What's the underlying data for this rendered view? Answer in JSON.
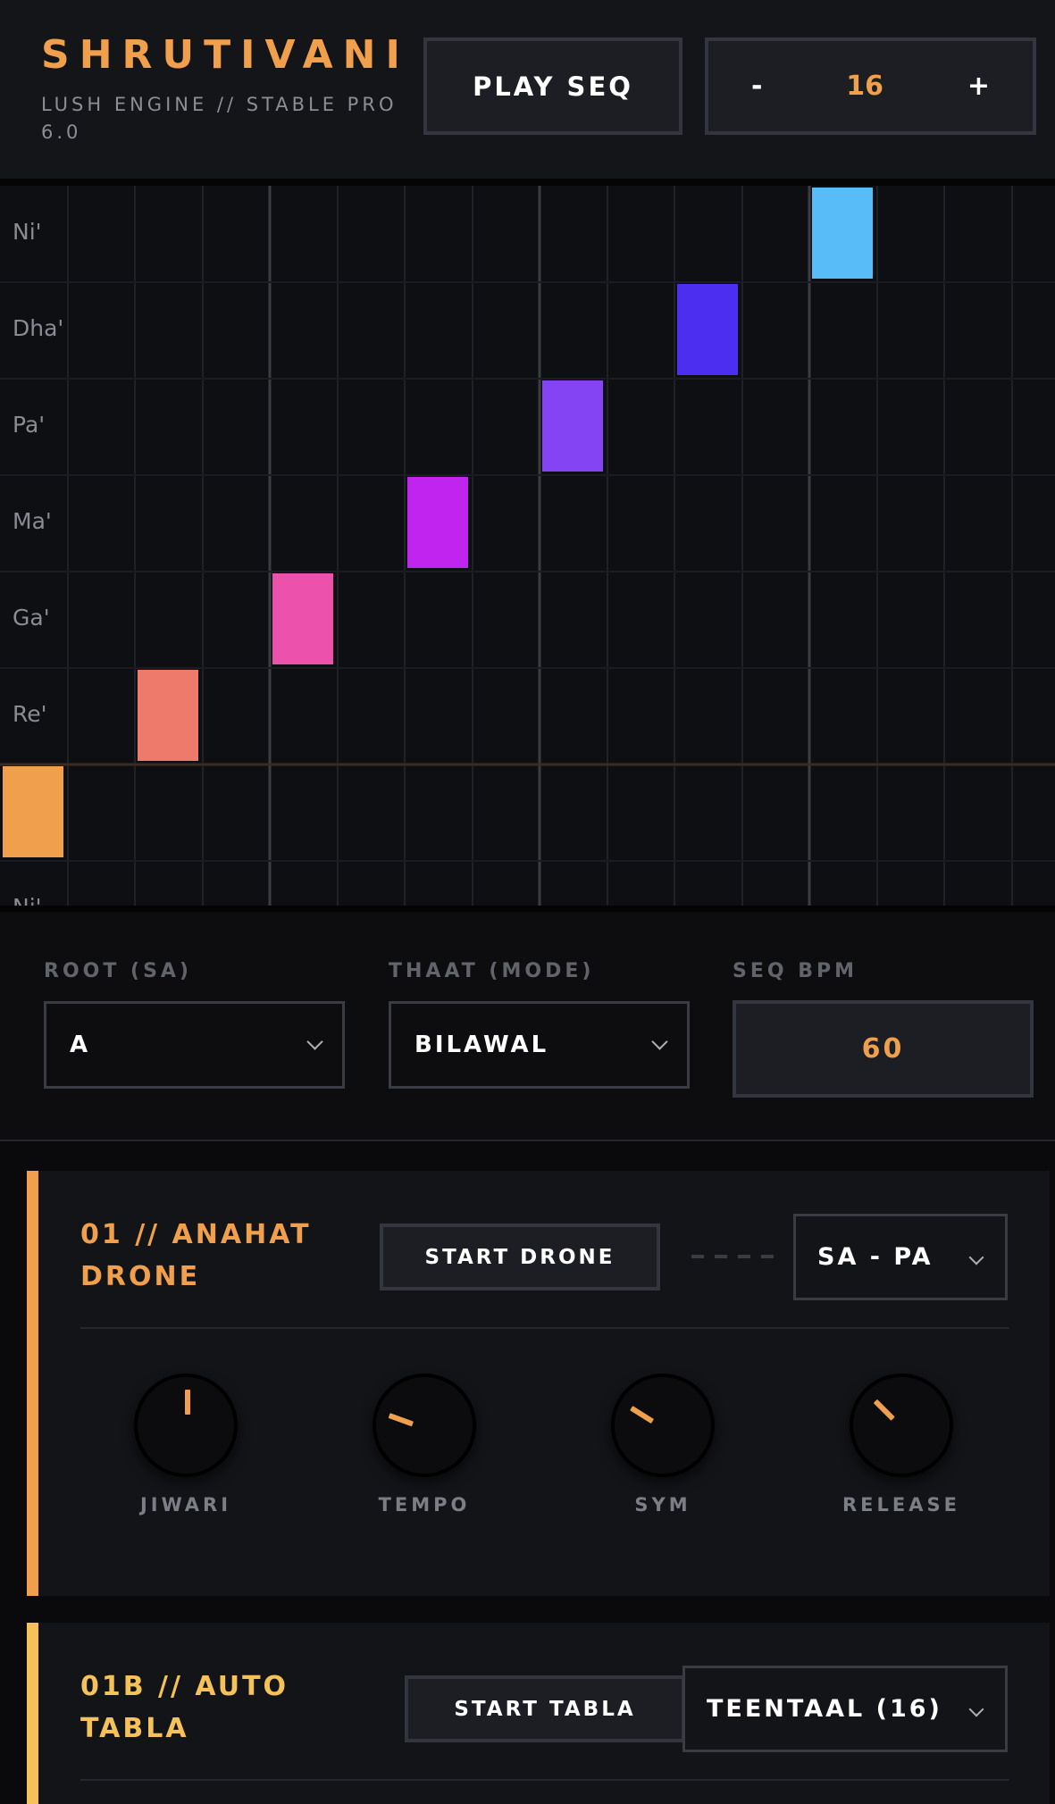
{
  "header": {
    "brand": "SHRUTIVANI",
    "subtitle": "LUSH ENGINE // STABLE PRO 6.0",
    "play_label": "PLAY SEQ",
    "step_minus": "-",
    "step_value": "16",
    "step_plus": "+"
  },
  "grid": {
    "rows": [
      "Ni'",
      "Dha'",
      "Pa'",
      "Ma'",
      "Ga'",
      "Re'",
      "",
      "Ni'"
    ],
    "steps": 16,
    "notes": [
      {
        "step": 0,
        "row": 6,
        "color": "#f0a04c"
      },
      {
        "step": 2,
        "row": 5,
        "color": "#ee7a6c"
      },
      {
        "step": 4,
        "row": 4,
        "color": "#ec52ac"
      },
      {
        "step": 6,
        "row": 3,
        "color": "#c224f0"
      },
      {
        "step": 8,
        "row": 2,
        "color": "#8444f4"
      },
      {
        "step": 10,
        "row": 1,
        "color": "#4c2ef0"
      },
      {
        "step": 12,
        "row": 0,
        "color": "#58bcf8"
      }
    ]
  },
  "controls": {
    "root_label": "ROOT (SA)",
    "root_value": "A",
    "thaat_label": "THAAT (MODE)",
    "thaat_value": "BILAWAL",
    "bpm_label": "SEQ BPM",
    "bpm_value": "60"
  },
  "drone": {
    "title_line1": "01 // ANAHAT",
    "title_line2": "DRONE",
    "start_label": "START DRONE",
    "mode_value": "SA - PA",
    "accent": "#f0a04c",
    "knobs": [
      {
        "label": "JIWARI",
        "angle": 0
      },
      {
        "label": "TEMPO",
        "angle": -70
      },
      {
        "label": "SYM",
        "angle": -58
      },
      {
        "label": "RELEASE",
        "angle": -45
      }
    ]
  },
  "tabla": {
    "title_line1": "01B // AUTO",
    "title_line2": "TABLA",
    "start_label": "START TABLA",
    "taal_value": "TEENTAAL (16)",
    "accent": "#f5c25a"
  }
}
